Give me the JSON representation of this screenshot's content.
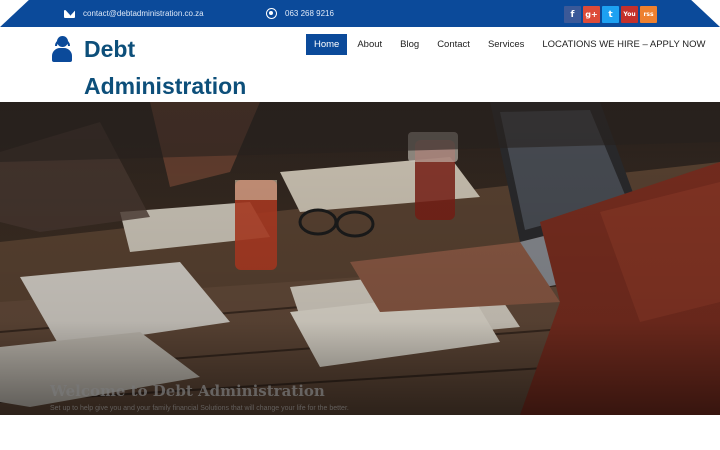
{
  "topbar": {
    "email": "contact@debtadministration.co.za",
    "phone": "063 268 9216",
    "socials": [
      {
        "name": "facebook",
        "glyph": "f",
        "color": "#3b5998"
      },
      {
        "name": "google-plus",
        "glyph": "g+",
        "color": "#dd4b39"
      },
      {
        "name": "twitter",
        "glyph": "t",
        "color": "#1da1f2"
      },
      {
        "name": "youtube",
        "glyph": "You",
        "color": "#c4302b"
      },
      {
        "name": "rss",
        "glyph": "rss",
        "color": "#ee802f"
      }
    ]
  },
  "header": {
    "title": "Debt Administration",
    "logo_icon": "support-agent-icon"
  },
  "nav": {
    "items": [
      "Home",
      "About",
      "Blog",
      "Contact",
      "Services",
      "LOCATIONS WE HIRE – APPLY NOW"
    ],
    "active": "Home"
  },
  "hero": {
    "title": "Welcome to Debt Administration",
    "subtitle": "Set up to help give you and your family financial Solutions that will change your life for the better."
  },
  "colors": {
    "brand_blue": "#0b4a9a",
    "title_color": "#0d4f7a"
  }
}
